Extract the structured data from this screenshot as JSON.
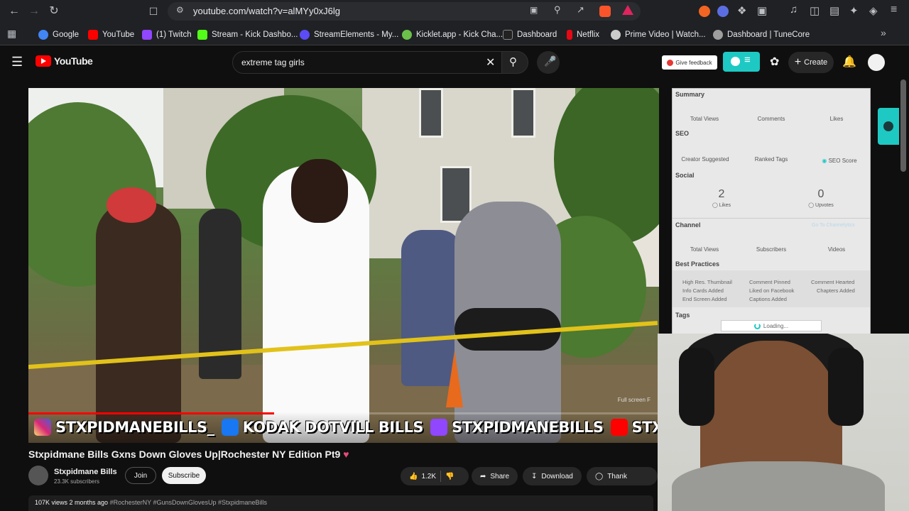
{
  "browser": {
    "url": "youtube.com/watch?v=alMYy0xJ6lg",
    "bookmarks": [
      {
        "label": "Google",
        "color": "#4285f4"
      },
      {
        "label": "YouTube",
        "color": "#ff0000"
      },
      {
        "label": "(1) Twitch",
        "color": "#9146ff"
      },
      {
        "label": "Stream - Kick Dashbo...",
        "color": "#53fc18"
      },
      {
        "label": "StreamElements - My...",
        "color": "#5b4cf5"
      },
      {
        "label": "Kicklet.app - Kick Cha...",
        "color": "#6cc04a"
      },
      {
        "label": "Dashboard",
        "color": "#222222"
      },
      {
        "label": "Netflix",
        "color": "#e50914"
      },
      {
        "label": "Prime Video | Watch...",
        "color": "#cccccc"
      },
      {
        "label": "Dashboard | TuneCore",
        "color": "#9e9e9e"
      }
    ]
  },
  "header": {
    "logo_text": "YouTube",
    "search_value": "extreme tag girls",
    "feedback_label": "Give feedback",
    "create_label": "Create"
  },
  "video": {
    "overlay_socials": [
      "STXPIDMANEBILLS_",
      "KODAK DOTVILL BILLS",
      "STXPIDMANEBILLS",
      "STXPIDMANEBILLS"
    ],
    "fullscreen_hint": "Full screen  F",
    "progress": 0.39,
    "title": "Stxpidmane Bills Gxns Down Gloves Up|Rochester NY Edition Pt9"
  },
  "channel": {
    "name": "Stxpidmane Bills",
    "subscribers": "23.3K subscribers",
    "join_label": "Join",
    "subscribe_label": "Subscribe"
  },
  "actions": {
    "likes": "1.2K",
    "share": "Share",
    "download": "Download",
    "thanks": "Thank"
  },
  "description": {
    "stats": "107K views  2 months ago",
    "tags": "#RochesterNY #GunsDownGlovesUp #StxpidmaneBills"
  },
  "panel": {
    "summary_title": "Summary",
    "summary_labels": [
      "Total Views",
      "Comments",
      "Likes"
    ],
    "seo_title": "SEO",
    "seo_labels": [
      "Creator Suggested",
      "Ranked Tags",
      "SEO Score"
    ],
    "social_title": "Social",
    "social_likes_value": "2",
    "social_likes_label": "Likes",
    "social_upvotes_value": "0",
    "social_upvotes_label": "Upvotes",
    "channel_title": "Channel",
    "channel_link": "Go To Channelytics",
    "channel_labels": [
      "Total Views",
      "Subscribers",
      "Videos"
    ],
    "best_practices_title": "Best Practices",
    "best_practices": [
      "High Res. Thumbnail",
      "Comment Pinned",
      "Comment Hearted",
      "Info Cards Added",
      "Liked on Facebook",
      "Chapters Added",
      "End Screen Added",
      "Captions Added"
    ],
    "tags_title": "Tags",
    "loading_text": "Loading..."
  }
}
